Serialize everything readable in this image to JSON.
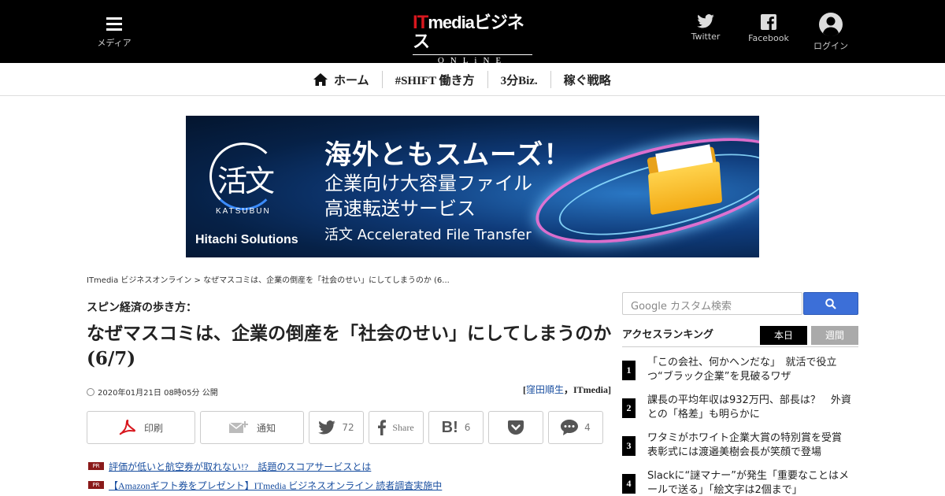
{
  "header": {
    "menu_label": "メディア",
    "logo_main_prefix": "IT",
    "logo_main_rest": "mediaビジネス",
    "logo_sub": "ONLiNE",
    "twitter_label": "Twitter",
    "facebook_label": "Facebook",
    "login_label": "ログイン"
  },
  "nav": {
    "items": [
      {
        "label": "ホーム",
        "icon": "home-icon"
      },
      {
        "label": "#SHIFT 働き方"
      },
      {
        "label": "3分Biz."
      },
      {
        "label": "稼ぐ戦略"
      }
    ]
  },
  "banner": {
    "logo_kanji": "活文",
    "logo_sub": "KATSUBUN",
    "headline": "海外ともスムーズ！",
    "line1": "企業向け大容量ファイル",
    "line2": "高速転送サービス",
    "line3": "活文 Accelerated File Transfer",
    "company": "Hitachi Solutions"
  },
  "article": {
    "breadcrumb": "ITmedia ビジネスオンライン > なぜマスコミは、企業の倒産を「社会のせい」にしてしまうのか (6...",
    "kicker": "スピン経済の歩き方：",
    "title": "なぜマスコミは、企業の倒産を「社会のせい」にしてしまうのか (6/7)",
    "date": "2020年01月21日 08時05分 公開",
    "author_open": "[",
    "author_name": "窪田順生",
    "author_sep": "，",
    "author_org": "ITmedia",
    "author_close": "]"
  },
  "share": {
    "print_label": "印刷",
    "notify_label": "通知",
    "twitter_count": "72",
    "facebook_label": "Share",
    "hatena_count": "6",
    "comment_count": "4"
  },
  "pr_links": [
    {
      "badge": "PR",
      "text": "評価が低いと航空券が取れない!?　話題のスコアサービスとは"
    },
    {
      "badge": "PR",
      "text": "【Amazonギフト券をプレゼント】ITmedia ビジネスオンライン 読者調査実施中"
    }
  ],
  "sidebar": {
    "search_placeholder": "Google カスタム検索",
    "ranking_title": "アクセスランキング",
    "tab_today": "本日",
    "tab_week": "週間",
    "ranking": [
      {
        "num": "1",
        "text": "「この会社、何かヘンだな」　就活で役立つ“ブラック企業”を見破るワザ"
      },
      {
        "num": "2",
        "text": "課長の平均年収は932万円、部長は？　外資との「格差」も明らかに"
      },
      {
        "num": "3",
        "text": "ワタミがホワイト企業大賞の特別賞を受賞　表彰式には渡邉美樹会長が笑顔で登場"
      },
      {
        "num": "4",
        "text": "Slackに“謎マナー”が発生「重要なことはメールで送る」「絵文字は2個まで」"
      }
    ]
  },
  "colors": {
    "header_bg": "#000000",
    "logo_accent": "#d8171e",
    "link": "#1a4fa0",
    "search_button": "#3c6fd8"
  }
}
